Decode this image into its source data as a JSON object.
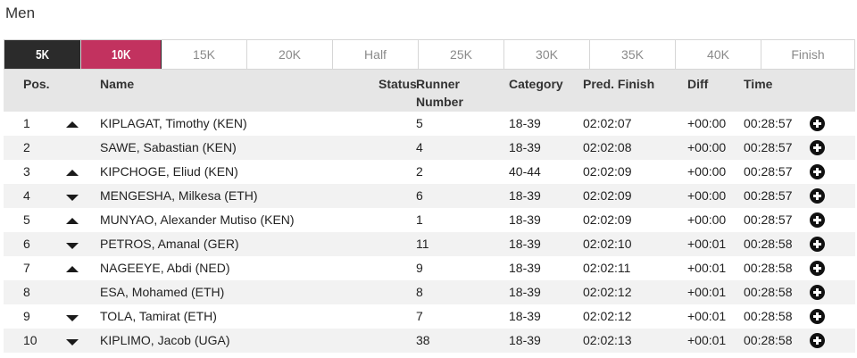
{
  "page": {
    "title": "Men"
  },
  "tabs": [
    {
      "label": "5K",
      "state": "dark"
    },
    {
      "label": "10K",
      "state": "active"
    },
    {
      "label": "15K"
    },
    {
      "label": "20K"
    },
    {
      "label": "Half"
    },
    {
      "label": "25K"
    },
    {
      "label": "30K"
    },
    {
      "label": "35K"
    },
    {
      "label": "40K"
    },
    {
      "label": "Finish"
    }
  ],
  "colors": {
    "tab_dark": "#2b2b2b",
    "tab_active": "#c2325f",
    "header_bg": "#e6e6e6",
    "row_alt": "#f2f2f2"
  },
  "table": {
    "headers": {
      "pos": "Pos.",
      "name": "Name",
      "status": "Status",
      "runner_number_1": "Runner",
      "runner_number_2": "Number",
      "category": "Category",
      "pred_finish": "Pred. Finish",
      "diff": "Diff",
      "time": "Time"
    },
    "rows": [
      {
        "pos": "1",
        "trend": "up",
        "name": "KIPLAGAT, Timothy (KEN)",
        "bib": "5",
        "category": "18-39",
        "pred": "02:02:07",
        "diff": "+00:00",
        "time": "00:28:57",
        "action_icon": "plus-circle-icon"
      },
      {
        "pos": "2",
        "trend": "none",
        "name": "SAWE, Sabastian (KEN)",
        "bib": "4",
        "category": "18-39",
        "pred": "02:02:08",
        "diff": "+00:00",
        "time": "00:28:57",
        "action_icon": "plus-circle-icon"
      },
      {
        "pos": "3",
        "trend": "up",
        "name": "KIPCHOGE, Eliud (KEN)",
        "bib": "2",
        "category": "40-44",
        "pred": "02:02:09",
        "diff": "+00:00",
        "time": "00:28:57",
        "action_icon": "plus-circle-icon"
      },
      {
        "pos": "4",
        "trend": "down",
        "name": "MENGESHA, Milkesa (ETH)",
        "bib": "6",
        "category": "18-39",
        "pred": "02:02:09",
        "diff": "+00:00",
        "time": "00:28:57",
        "action_icon": "plus-circle-icon"
      },
      {
        "pos": "5",
        "trend": "up",
        "name": "MUNYAO, Alexander Mutiso (KEN)",
        "bib": "1",
        "category": "18-39",
        "pred": "02:02:09",
        "diff": "+00:00",
        "time": "00:28:57",
        "action_icon": "plus-circle-icon"
      },
      {
        "pos": "6",
        "trend": "down",
        "name": "PETROS, Amanal (GER)",
        "bib": "11",
        "category": "18-39",
        "pred": "02:02:10",
        "diff": "+00:01",
        "time": "00:28:58",
        "action_icon": "plus-circle-icon"
      },
      {
        "pos": "7",
        "trend": "up",
        "name": "NAGEEYE, Abdi (NED)",
        "bib": "9",
        "category": "18-39",
        "pred": "02:02:11",
        "diff": "+00:01",
        "time": "00:28:58",
        "action_icon": "plus-circle-icon"
      },
      {
        "pos": "8",
        "trend": "none",
        "name": "ESA, Mohamed (ETH)",
        "bib": "8",
        "category": "18-39",
        "pred": "02:02:12",
        "diff": "+00:01",
        "time": "00:28:58",
        "action_icon": "plus-circle-icon"
      },
      {
        "pos": "9",
        "trend": "down",
        "name": "TOLA, Tamirat (ETH)",
        "bib": "7",
        "category": "18-39",
        "pred": "02:02:12",
        "diff": "+00:01",
        "time": "00:28:58",
        "action_icon": "plus-circle-icon"
      },
      {
        "pos": "10",
        "trend": "down",
        "name": "KIPLIMO, Jacob (UGA)",
        "bib": "38",
        "category": "18-39",
        "pred": "02:02:13",
        "diff": "+00:01",
        "time": "00:28:58",
        "action_icon": "plus-circle-icon"
      }
    ]
  }
}
